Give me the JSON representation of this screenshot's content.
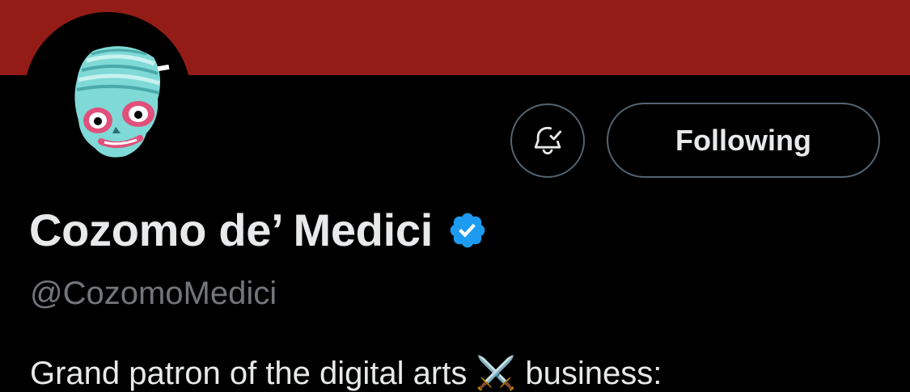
{
  "profile": {
    "display_name": "Cozomo de’ Medici",
    "handle": "@CozomoMedici",
    "bio_visible_text": "Grand patron of the digital arts ⚔️ business:"
  },
  "actions": {
    "following_label": "Following",
    "notification_icon": "bell-check-icon"
  },
  "badges": {
    "verified_icon": "verified-badge-icon"
  },
  "colors": {
    "banner": "#941c16",
    "background": "#000000",
    "text_primary": "#e7e9ea",
    "text_secondary": "#71767b",
    "button_border": "#536471",
    "verified_blue": "#1d9bf0"
  }
}
